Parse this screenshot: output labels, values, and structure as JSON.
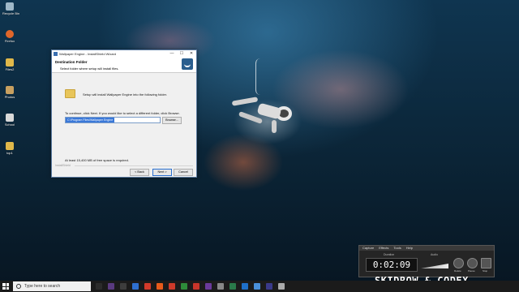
{
  "desktop": {
    "icons": [
      {
        "label": "Recycle Bin",
        "color": "#9fb8c8"
      },
      {
        "label": "Firefox",
        "color": "#e0662a"
      },
      {
        "label": "Files2",
        "color": "#e0b84a"
      },
      {
        "label": "Photos",
        "color": "#c8a060"
      },
      {
        "label": "School",
        "color": "#d9d9d9"
      },
      {
        "label": "top1",
        "color": "#e0b84a"
      }
    ]
  },
  "installer": {
    "title": "Wallpaper Engine - InstallShield Wizard",
    "heading": "Destination Folder",
    "subheading": "Select folder where setup will install files.",
    "info": "Setup will install Wallpaper Engine into the following folder.",
    "instruction": "To continue, click Next. If you would like to select a different folder, click Browse.",
    "path": "C:\\Program Files\\Wallpaper Engine",
    "browse_label": "Browse...",
    "space_note": "At least 15,400 MB of free space is required.",
    "brand": "InstallShield",
    "back_label": "< Back",
    "next_label": "Next >",
    "cancel_label": "Cancel",
    "minimize": "—",
    "maximize": "☐",
    "close": "✕"
  },
  "recorder": {
    "menu": [
      "Capture",
      "Effects",
      "Tools",
      "Help"
    ],
    "duration_label": "Duration",
    "duration": "0:02:09",
    "audio_label": "Audio",
    "buttons": [
      "Delete",
      "Pause",
      "Stop"
    ]
  },
  "watermark": "SKIDROW & CODEX",
  "taskbar": {
    "search_placeholder": "Type here to search",
    "icons": [
      "#2b2b2b",
      "#5a3a80",
      "#3d3d3d",
      "#2f6fcf",
      "#d33a2a",
      "#e85a1a",
      "#cf3a2a",
      "#2e8b3a",
      "#c8352a",
      "#6a3a9a",
      "#888888",
      "#2a7a4a",
      "#1f6fc8",
      "#4a90d9",
      "#3a3a8a",
      "#aaaaaa"
    ]
  }
}
